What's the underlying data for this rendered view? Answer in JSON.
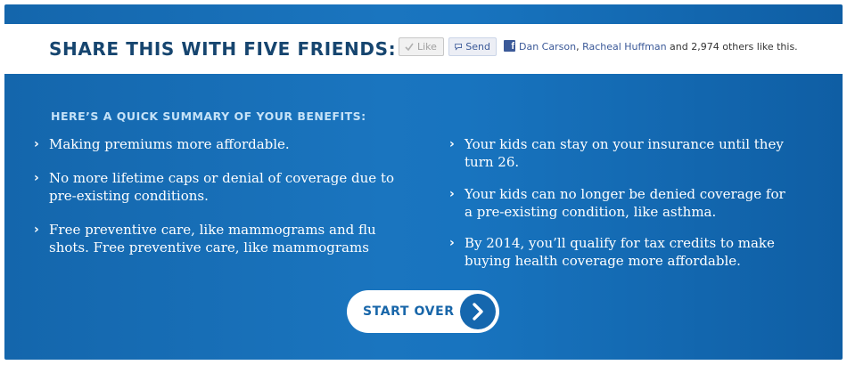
{
  "share": {
    "title": "SHARE THIS WITH FIVE FRIENDS:",
    "like_label": "Like",
    "send_label": "Send",
    "friend1": "Dan Carson",
    "separator": ",",
    "friend2": "Racheal Huffman",
    "others_text": "and 2,974 others like this.",
    "fb_logo": "f"
  },
  "summary": {
    "heading": "HERE’S A QUICK SUMMARY OF YOUR BENEFITS:",
    "left_items": [
      "Making premiums more affordable.",
      "No more lifetime caps or denial of coverage due to pre-existing conditions.",
      "Free preventive care, like mammograms and flu shots. Free preventive care, like mammograms"
    ],
    "right_items": [
      "Your kids can stay on your insurance until they turn 26.",
      "Your kids can no longer be denied coverage for a pre-existing condition, like asthma.",
      "By 2014, you’ll qualify for tax credits to make buying health coverage more affordable."
    ]
  },
  "cta": {
    "label": "START OVER"
  },
  "colors": {
    "panel_blue": "#1a75bf",
    "title_navy": "#16456f",
    "facebook_blue": "#3b5998"
  }
}
